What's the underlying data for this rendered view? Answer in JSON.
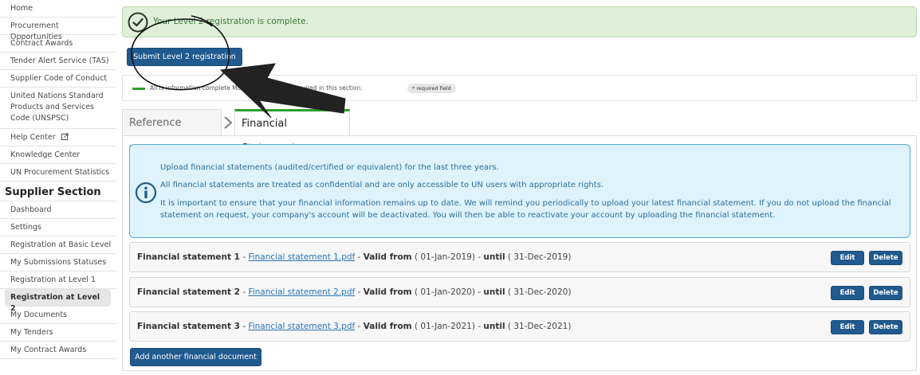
{
  "sidebar": {
    "items_top": [
      {
        "label": "Home"
      },
      {
        "label": "Procurement Opportunities"
      },
      {
        "label": "Contract Awards"
      },
      {
        "label": "Tender Alert Service (TAS)"
      },
      {
        "label": "Supplier Code of Conduct"
      },
      {
        "label": "United Nations Standard Products and Services Code (UNSPSC)"
      },
      {
        "label": "Help Center"
      },
      {
        "label": "Knowledge Center"
      },
      {
        "label": "UN Procurement Statistics"
      }
    ],
    "section_title": "Supplier Section",
    "items_supplier": [
      {
        "label": "Dashboard"
      },
      {
        "label": "Settings"
      },
      {
        "label": "Registration at Basic Level"
      },
      {
        "label": "My Submissions Statuses"
      },
      {
        "label": "Registration at Level 1"
      },
      {
        "label": "Registration at Level 2",
        "active": true
      },
      {
        "label": "My Documents"
      },
      {
        "label": "My Tenders"
      },
      {
        "label": "My Contract Awards"
      }
    ]
  },
  "banner": {
    "message": "Your Level 2 registration is complete.",
    "color": "#3c763d"
  },
  "submit_button": "Submit Level 2 registration",
  "legend": {
    "text": "All is information complete      More information is required in this section.",
    "required_badge": "* required field"
  },
  "tabs": [
    {
      "label": "Reference Letters"
    },
    {
      "label": "Financial Statements",
      "active": true
    }
  ],
  "info": {
    "line1": "Upload financial statements (audited/certified or equivalent) for the last three years.",
    "line2": "All financial statements are treated as confidential and are only accessible to UN users with appropriate rights.",
    "line3": "It is important to ensure that your financial information remains up to date. We will remind you periodically to upload your latest financial statement. If you do not upload the financial statement on request, your company's account will be deactivated. You will then be able to reactivate your account by uploading the financial statement."
  },
  "statements": [
    {
      "title": "Financial statement 1",
      "file": "Financial statement 1.pdf",
      "valid_from_label": "Valid from",
      "from": "( 01-Jan-2019)",
      "until_label": "until",
      "until": "( 31-Dec-2019)"
    },
    {
      "title": "Financial statement 2",
      "file": "Financial statement 2.pdf",
      "valid_from_label": "Valid from",
      "from": "( 01-Jan-2020)",
      "until_label": "until",
      "until": "( 31-Dec-2020)"
    },
    {
      "title": "Financial statement 3",
      "file": "Financial statement 3.pdf",
      "valid_from_label": "Valid from",
      "from": "( 01-Jan-2021)",
      "until_label": "until",
      "until": "( 31-Dec-2021)"
    }
  ],
  "row_buttons": {
    "edit": "Edit",
    "delete": "Delete"
  },
  "add_button": "Add another financial document",
  "colors": {
    "primary": "#205a8e",
    "success": "#2ca02c",
    "info_border": "#5aa9d6"
  }
}
